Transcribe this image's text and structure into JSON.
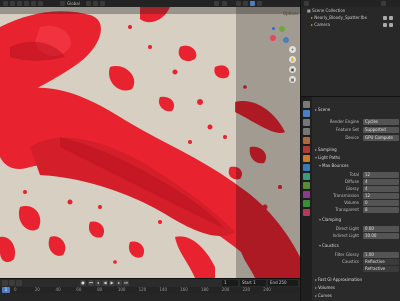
{
  "header": {
    "mode": "Global",
    "options": "Options"
  },
  "outliner": {
    "title": "Scene Collection",
    "items": [
      {
        "label": "Nearly_Bloody_Spatter.fbx"
      },
      {
        "label": "Camera"
      }
    ]
  },
  "viewport": {
    "nav_labels": [
      "X",
      "Y",
      "Z"
    ]
  },
  "timeline": {
    "current_frame": "1",
    "start_label": "Start",
    "start": "1",
    "end_label": "End",
    "end": "250",
    "ticks": [
      "0",
      "20",
      "40",
      "60",
      "80",
      "100",
      "120",
      "140",
      "160",
      "180",
      "200",
      "220",
      "240"
    ]
  },
  "properties": {
    "scene_label": "Scene",
    "rows": [
      {
        "label": "Render Engine",
        "value": "Cycles"
      },
      {
        "label": "Feature Set",
        "value": "Supported"
      },
      {
        "label": "Device",
        "value": "GPU Compute"
      }
    ],
    "sampling": "Sampling",
    "light_paths": "Light Paths",
    "max_bounces": "Max Bounces",
    "bounces": [
      {
        "label": "Total",
        "value": "12"
      },
      {
        "label": "Diffuse",
        "value": "4"
      },
      {
        "label": "Glossy",
        "value": "4"
      },
      {
        "label": "Transmission",
        "value": "12"
      },
      {
        "label": "Volume",
        "value": "0"
      },
      {
        "label": "Transparent",
        "value": "8"
      }
    ],
    "clamping": "Clamping",
    "clamp_rows": [
      {
        "label": "Direct Light",
        "value": "0.00"
      },
      {
        "label": "Indirect Light",
        "value": "10.00"
      }
    ],
    "caustics": "Caustics",
    "caustic_rows": [
      {
        "label": "Filter Glossy",
        "value": "1.00"
      },
      {
        "label": "Caustics",
        "value": "Reflective"
      },
      {
        "label": "",
        "value": "Refractive"
      }
    ],
    "fast_gi": "Fast GI Approximation",
    "volumes": "Volumes",
    "curves": "Curves"
  },
  "colors": {
    "blood": "#e8232f",
    "background": "#d7cfc2",
    "accent": "#4a7fc2"
  }
}
